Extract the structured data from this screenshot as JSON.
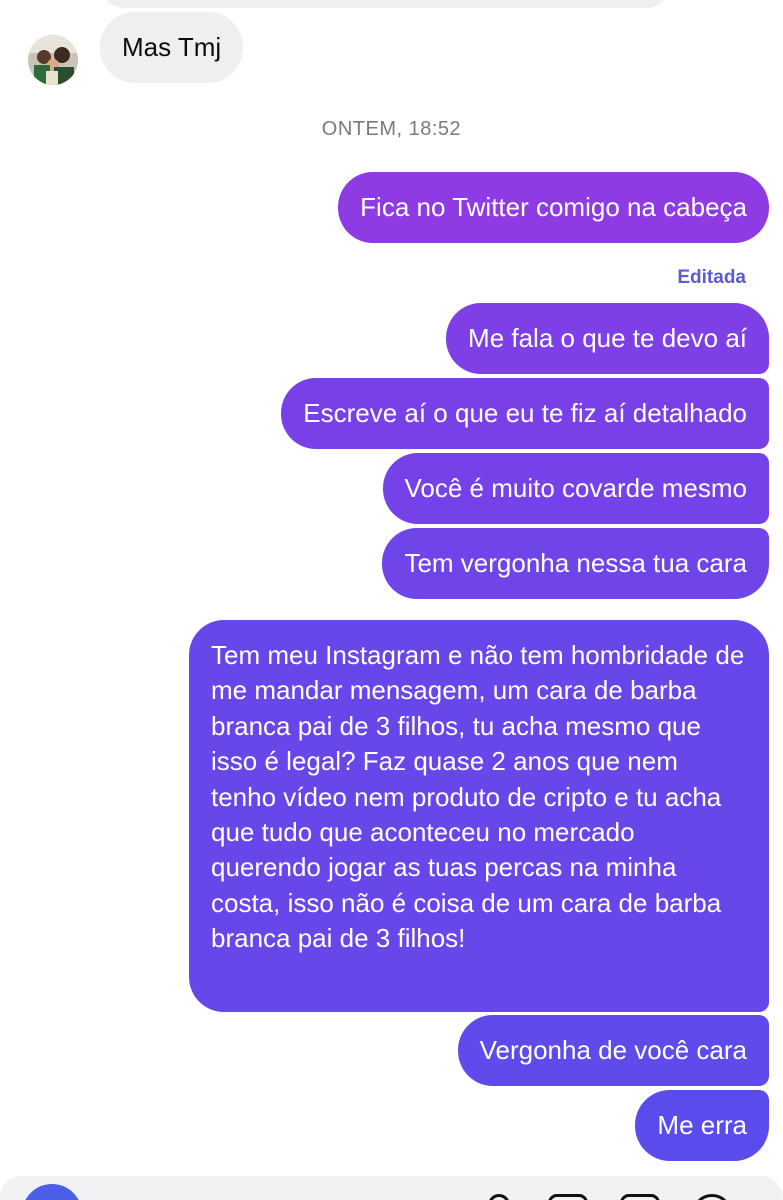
{
  "conversation": {
    "incoming": {
      "text": "Mas Tmj"
    },
    "timestamp": "ONTEM, 18:52",
    "edited_label": "Editada",
    "outgoing": [
      {
        "text": "Fica no Twitter comigo na cabeça"
      },
      {
        "text": "Me fala o que te devo aí"
      },
      {
        "text": "Escreve aí o que eu te fiz aí detalhado"
      },
      {
        "text": "Você é muito covarde mesmo"
      },
      {
        "text": "Tem vergonha nessa tua cara"
      },
      {
        "text": "Tem meu Instagram e não tem hombridade de me mandar mensagem, um cara de barba branca pai de 3 filhos, tu acha mesmo que isso é legal? Faz quase 2 anos que nem tenho vídeo nem produto de cripto e tu acha que tudo que aconteceu no mercado querendo jogar as tuas percas na minha costa, isso não é coisa de um cara de barba branca pai de 3 filhos!"
      },
      {
        "text": "Vergonha de você cara"
      },
      {
        "text": "Me erra"
      }
    ]
  },
  "colors": {
    "incoming_bubble": "#efeff2",
    "gradient_top": "#8f3be4",
    "gradient_bottom": "#5a4cec",
    "edited_label": "#5b5bd6"
  },
  "icons": {
    "avatar": "avatar-photo",
    "composer_camera": "camera-icon",
    "composer_mic": "microphone-icon",
    "composer_gallery": "gallery-icon",
    "composer_sticker": "sticker-icon",
    "composer_plus": "plus-icon"
  }
}
